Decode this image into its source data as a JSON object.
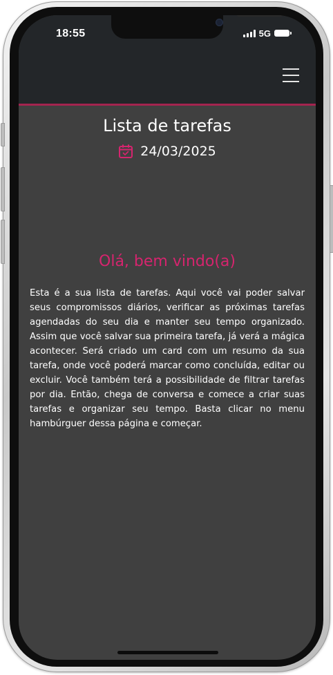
{
  "status_bar": {
    "time": "18:55",
    "network": "5G",
    "signal_icon": "signal-bars-icon",
    "battery_icon": "battery-icon"
  },
  "header": {
    "menu_icon": "hamburger-menu-icon",
    "accent_color": "#a4244f"
  },
  "main": {
    "title": "Lista de tarefas",
    "date_icon": "calendar-check-icon",
    "date": "24/03/2025",
    "welcome": "Olá, bem vindo(a)",
    "intro": "Esta é a sua lista de tarefas. Aqui você vai poder salvar seus compromissos diários, verificar as próximas tarefas agendadas do seu dia e manter seu tempo organizado. Assim que você salvar sua primeira tarefa, já verá a mágica acontecer. Será criado um card com um resumo da sua tarefa, onde você poderá marcar como concluída, editar ou excluir. Você também terá a possibilidade de filtrar tarefas por dia. Então, chega de conversa e comece a criar suas tarefas e organizar seu tempo. Basta clicar no menu hambúrguer dessa página e começar."
  },
  "colors": {
    "background": "#404040",
    "header_background": "#232629",
    "accent_pink": "#d6246e",
    "text": "#ffffff"
  }
}
